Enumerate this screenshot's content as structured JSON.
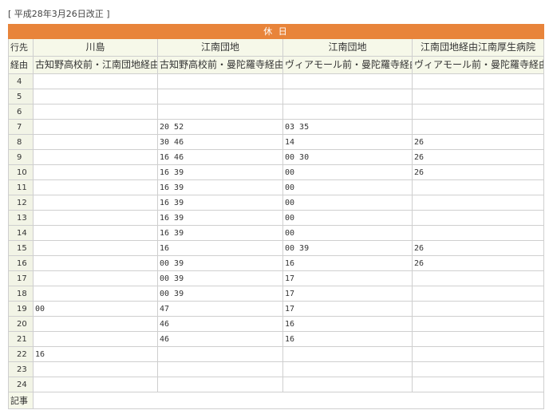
{
  "revision": "[ 平成28年3月26日改正 ]",
  "day_type": "休 日",
  "labels": {
    "destination": "行先",
    "route": "経由",
    "notes": "記事"
  },
  "columns": [
    {
      "destination": "川島",
      "route": "古知野高校前・江南団地経由"
    },
    {
      "destination": "江南団地",
      "route": "古知野高校前・曼陀羅寺経由"
    },
    {
      "destination": "江南団地",
      "route": "ヴィアモール前・曼陀羅寺経由"
    },
    {
      "destination": "江南団地経由江南厚生病院",
      "route": "ヴィアモール前・曼陀羅寺経由"
    }
  ],
  "rows": [
    {
      "hour": "4",
      "cells": [
        "",
        "",
        "",
        ""
      ]
    },
    {
      "hour": "5",
      "cells": [
        "",
        "",
        "",
        ""
      ]
    },
    {
      "hour": "6",
      "cells": [
        "",
        "",
        "",
        ""
      ]
    },
    {
      "hour": "7",
      "cells": [
        "",
        "20  52",
        "03  35",
        ""
      ]
    },
    {
      "hour": "8",
      "cells": [
        "",
        "30  46",
        "14",
        "26"
      ]
    },
    {
      "hour": "9",
      "cells": [
        "",
        "16  46",
        "00  30",
        "26"
      ]
    },
    {
      "hour": "10",
      "cells": [
        "",
        "16  39",
        "00",
        "26"
      ]
    },
    {
      "hour": "11",
      "cells": [
        "",
        "16  39",
        "00",
        ""
      ]
    },
    {
      "hour": "12",
      "cells": [
        "",
        "16  39",
        "00",
        ""
      ]
    },
    {
      "hour": "13",
      "cells": [
        "",
        "16  39",
        "00",
        ""
      ]
    },
    {
      "hour": "14",
      "cells": [
        "",
        "16  39",
        "00",
        ""
      ]
    },
    {
      "hour": "15",
      "cells": [
        "",
        "16",
        "00  39",
        "26"
      ]
    },
    {
      "hour": "16",
      "cells": [
        "",
        "00  39",
        "16",
        "26"
      ]
    },
    {
      "hour": "17",
      "cells": [
        "",
        "00  39",
        "17",
        ""
      ]
    },
    {
      "hour": "18",
      "cells": [
        "",
        "00  39",
        "17",
        ""
      ]
    },
    {
      "hour": "19",
      "cells": [
        "00",
        "47",
        "17",
        ""
      ]
    },
    {
      "hour": "20",
      "cells": [
        "",
        "46",
        "16",
        ""
      ]
    },
    {
      "hour": "21",
      "cells": [
        "",
        "46",
        "16",
        ""
      ]
    },
    {
      "hour": "22",
      "cells": [
        "16",
        "",
        "",
        ""
      ]
    },
    {
      "hour": "23",
      "cells": [
        "",
        "",
        "",
        ""
      ]
    },
    {
      "hour": "24",
      "cells": [
        "",
        "",
        "",
        ""
      ]
    }
  ],
  "notes": ""
}
